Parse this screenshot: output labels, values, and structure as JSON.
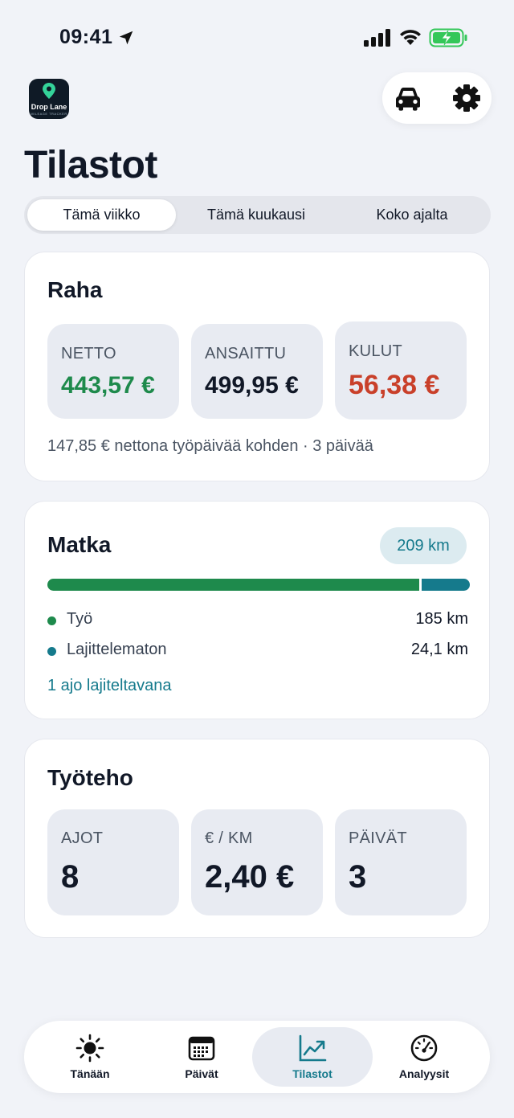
{
  "status_bar": {
    "time": "09:41"
  },
  "app": {
    "logo_text": "Drop Lane",
    "logo_subtext": "MILEAGE TRACKER"
  },
  "page": {
    "title": "Tilastot"
  },
  "period_tabs": [
    {
      "label": "Tämä viikko",
      "active": true
    },
    {
      "label": "Tämä kuukausi",
      "active": false
    },
    {
      "label": "Koko ajalta",
      "active": false
    }
  ],
  "raha": {
    "title": "Raha",
    "tiles": [
      {
        "label": "NETTO",
        "value": "443,57 €",
        "color": "#1e8a4c"
      },
      {
        "label": "ANSAITTU",
        "value": "499,95 €",
        "color": "#111827"
      },
      {
        "label": "KULUT",
        "value": "56,38 €",
        "color": "#c9402a"
      }
    ],
    "note": "147,85 € nettona työpäivää kohden · 3 päivää"
  },
  "matka": {
    "title": "Matka",
    "total": "209 km",
    "total_km": 209.1,
    "rows": [
      {
        "label": "Työ",
        "value": "185 km",
        "km": 185,
        "color": "#1e8a4c"
      },
      {
        "label": "Lajittelematon",
        "value": "24,1 km",
        "km": 24.1,
        "color": "#157a8c"
      }
    ],
    "link": "1 ajo lajiteltavana"
  },
  "tyoteho": {
    "title": "Työteho",
    "tiles": [
      {
        "label": "AJOT",
        "value": "8"
      },
      {
        "label": "€ / KM",
        "value": "2,40 €"
      },
      {
        "label": "PÄIVÄT",
        "value": "3"
      }
    ]
  },
  "bottom_nav": [
    {
      "label": "Tänään",
      "icon": "sun-icon",
      "active": false
    },
    {
      "label": "Päivät",
      "icon": "calendar-icon",
      "active": false
    },
    {
      "label": "Tilastot",
      "icon": "chart-icon",
      "active": true
    },
    {
      "label": "Analyysit",
      "icon": "speedometer-icon",
      "active": false
    }
  ],
  "colors": {
    "accent": "#157a8c",
    "positive": "#1e8a4c",
    "negative": "#c9402a",
    "background": "#f1f3f8"
  }
}
